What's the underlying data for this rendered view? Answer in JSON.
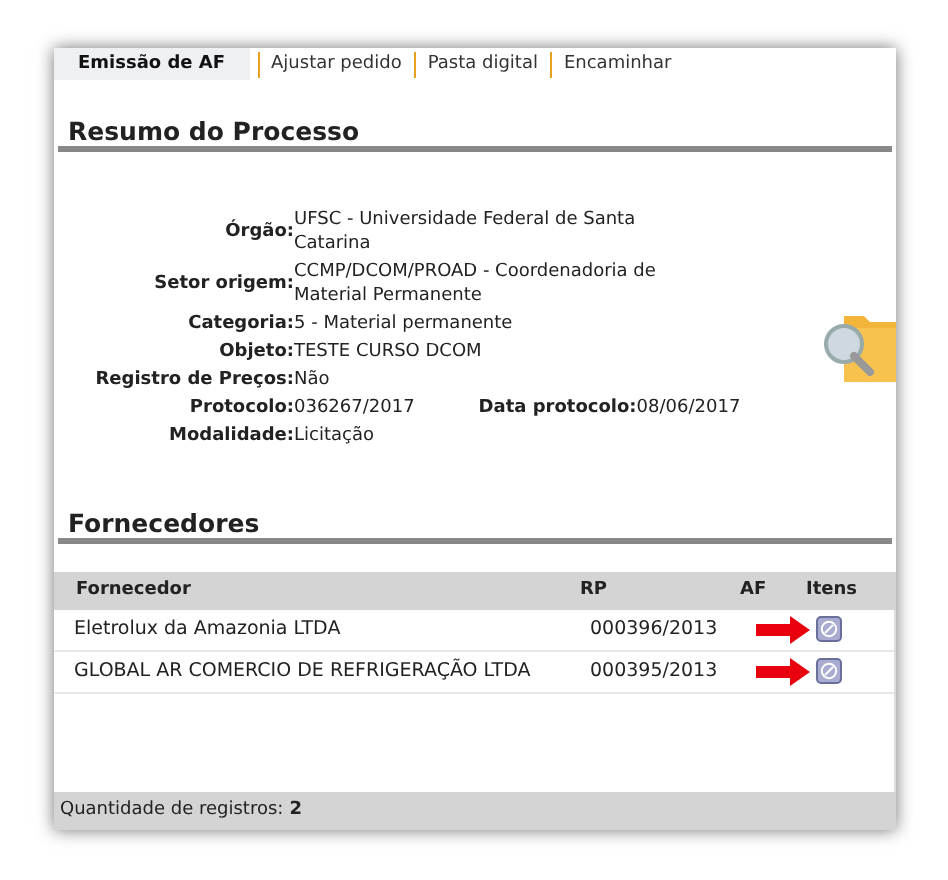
{
  "tabs": [
    {
      "label": "Emissão de AF",
      "selected": true
    },
    {
      "label": "Ajustar pedido",
      "selected": false
    },
    {
      "label": "Pasta digital",
      "selected": false
    },
    {
      "label": "Encaminhar",
      "selected": false
    }
  ],
  "summary": {
    "title": "Resumo do Processo",
    "rows": [
      [
        {
          "label": "Órgão:",
          "value": "UFSC - Universidade Federal de Santa Catarina"
        }
      ],
      [
        {
          "label": "Setor origem:",
          "value": "CCMP/DCOM/PROAD - Coordenadoria de Material Permanente"
        }
      ],
      [
        {
          "label": "Categoria:",
          "value": "5 - Material permanente"
        }
      ],
      [
        {
          "label": "Objeto:",
          "value": "TESTE CURSO DCOM"
        }
      ],
      [
        {
          "label": "Registro de Preços:",
          "value": "Não"
        }
      ],
      [
        {
          "label": "Protocolo:",
          "value": "036267/2017"
        },
        {
          "label": "Data protocolo:",
          "value": "08/06/2017"
        }
      ],
      [
        {
          "label": "Modalidade:",
          "value": "Licitação"
        }
      ]
    ]
  },
  "suppliers": {
    "title": "Fornecedores",
    "columns": [
      "Fornecedor",
      "RP",
      "AF",
      "Itens"
    ],
    "rows": [
      {
        "fornecedor": "Eletrolux da Amazonia LTDA",
        "rp": "000396/2013",
        "highlighted": true
      },
      {
        "fornecedor": "GLOBAL AR COMERCIO DE REFRIGERAÇÃO LTDA",
        "rp": "000395/2013",
        "highlighted": true
      }
    ],
    "footer_label": "Quantidade de registros:",
    "footer_count": "2"
  }
}
